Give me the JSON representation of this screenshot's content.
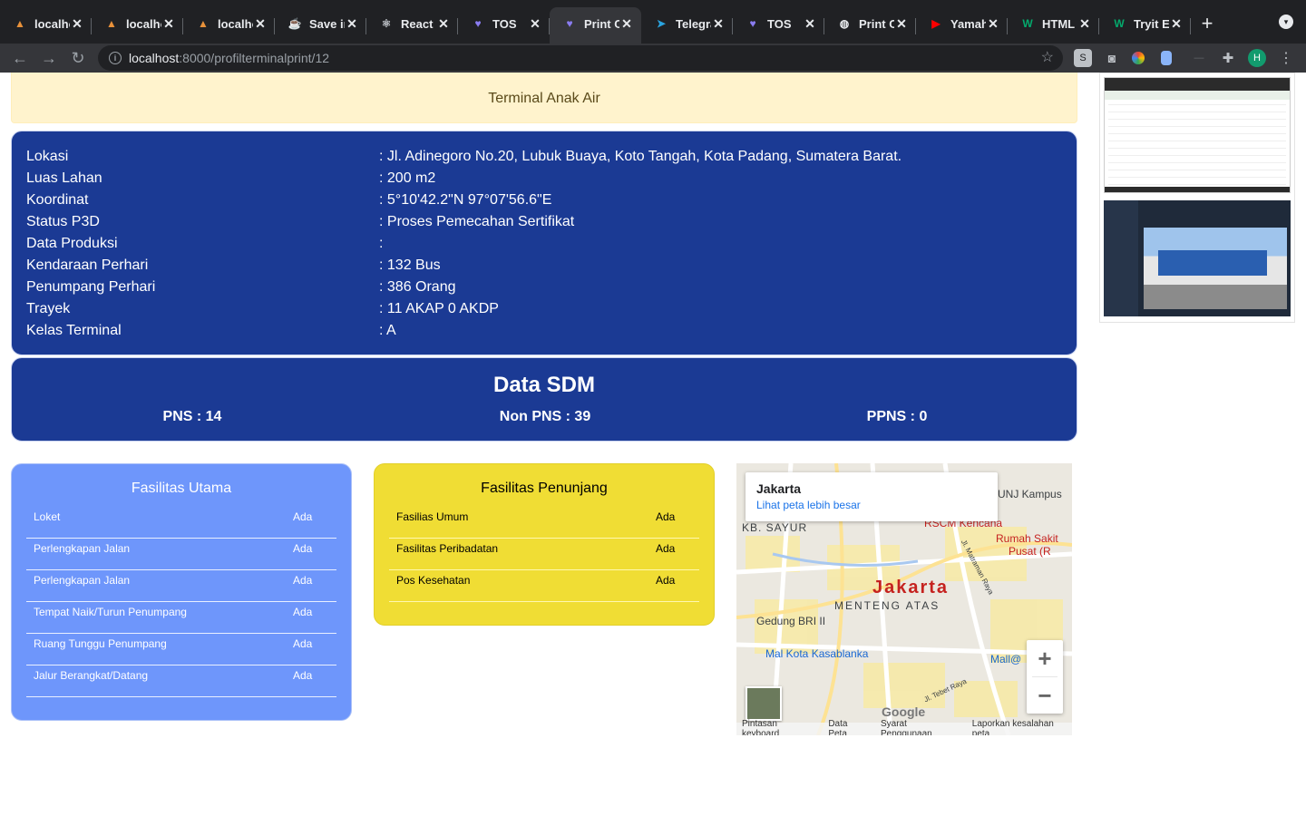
{
  "browser": {
    "tabs": [
      {
        "label": "localho",
        "icon": "tos-logo-icon",
        "active": false
      },
      {
        "label": "localho",
        "icon": "tos-logo-icon",
        "active": false
      },
      {
        "label": "localho",
        "icon": "tos-logo-icon",
        "active": false
      },
      {
        "label": "Save in",
        "icon": "java-icon",
        "active": false
      },
      {
        "label": "React",
        "icon": "react-icon",
        "active": false
      },
      {
        "label": "TOS",
        "icon": "heart-icon",
        "active": false
      },
      {
        "label": "Print C",
        "icon": "heart-icon",
        "active": true
      },
      {
        "label": "Telegra",
        "icon": "telegram-icon",
        "active": false
      },
      {
        "label": "TOS",
        "icon": "heart-icon",
        "active": false
      },
      {
        "label": "Print C",
        "icon": "globe-icon",
        "active": false
      },
      {
        "label": "Yamah",
        "icon": "youtube-icon",
        "active": false
      },
      {
        "label": "HTML",
        "icon": "w3-icon",
        "active": false
      },
      {
        "label": "Tryit E",
        "icon": "w3-icon",
        "active": false
      }
    ],
    "url_host": "localhost",
    "url_path": ":8000/profilterminalprint/12",
    "profile_initial": "H"
  },
  "header": {
    "terminal_name": "Terminal Anak Air"
  },
  "info": {
    "rows": [
      {
        "label": "Lokasi",
        "value": ": Jl. Adinegoro No.20, Lubuk Buaya, Koto Tangah, Kota Padang, Sumatera Barat."
      },
      {
        "label": "Luas Lahan",
        "value": ": 200 m2"
      },
      {
        "label": "Koordinat",
        "value": ": 5°10'42.2\"N 97°07'56.6\"E"
      },
      {
        "label": "Status P3D",
        "value": ": Proses Pemecahan Sertifikat"
      },
      {
        "label": "Data Produksi",
        "value": ":"
      },
      {
        "label": "Kendaraan Perhari",
        "value": ": 132 Bus"
      },
      {
        "label": "Penumpang Perhari",
        "value": ": 386 Orang"
      },
      {
        "label": "Trayek",
        "value": ": 11 AKAP 0 AKDP"
      },
      {
        "label": "Kelas Terminal",
        "value": ": A"
      }
    ]
  },
  "sdm": {
    "title": "Data SDM",
    "pns": "PNS : 14",
    "non_pns": "Non PNS : 39",
    "ppns": "PPNS : 0"
  },
  "fasilitas_utama": {
    "title": "Fasilitas Utama",
    "items": [
      {
        "name": "Loket",
        "status": "Ada"
      },
      {
        "name": "Perlengkapan Jalan",
        "status": "Ada"
      },
      {
        "name": "Perlengkapan Jalan",
        "status": "Ada"
      },
      {
        "name": "Tempat Naik/Turun Penumpang",
        "status": "Ada"
      },
      {
        "name": "Ruang Tunggu Penumpang",
        "status": "Ada"
      },
      {
        "name": "Jalur Berangkat/Datang",
        "status": "Ada"
      }
    ]
  },
  "fasilitas_penunjang": {
    "title": "Fasilitas Penunjang",
    "items": [
      {
        "name": "Fasilias Umum",
        "status": "Ada"
      },
      {
        "name": "Fasilitas Peribadatan",
        "status": "Ada"
      },
      {
        "name": "Pos Kesehatan",
        "status": "Ada"
      }
    ]
  },
  "map": {
    "place_title": "Jakarta",
    "larger_map_link": "Lihat peta lebih besar",
    "city_label": "Jakarta",
    "district_label": "MENTENG ATAS",
    "labels": [
      "KB. SAYUR",
      "RSCM Kencana",
      "UNJ Kampus",
      "Rumah Sakit",
      "Pusat (R",
      "Gedung BRI II",
      "Mal Kota Kasablanka",
      "Mall@",
      "Jl. Tebet Raya",
      "Jl. Matraman Raya"
    ],
    "google_logo": "Google",
    "zoom_in": "+",
    "zoom_out": "−",
    "footer": [
      "Pintasan keyboard",
      "Data Peta",
      "Syarat Penggunaan",
      "Laporkan kesalahan peta"
    ]
  }
}
